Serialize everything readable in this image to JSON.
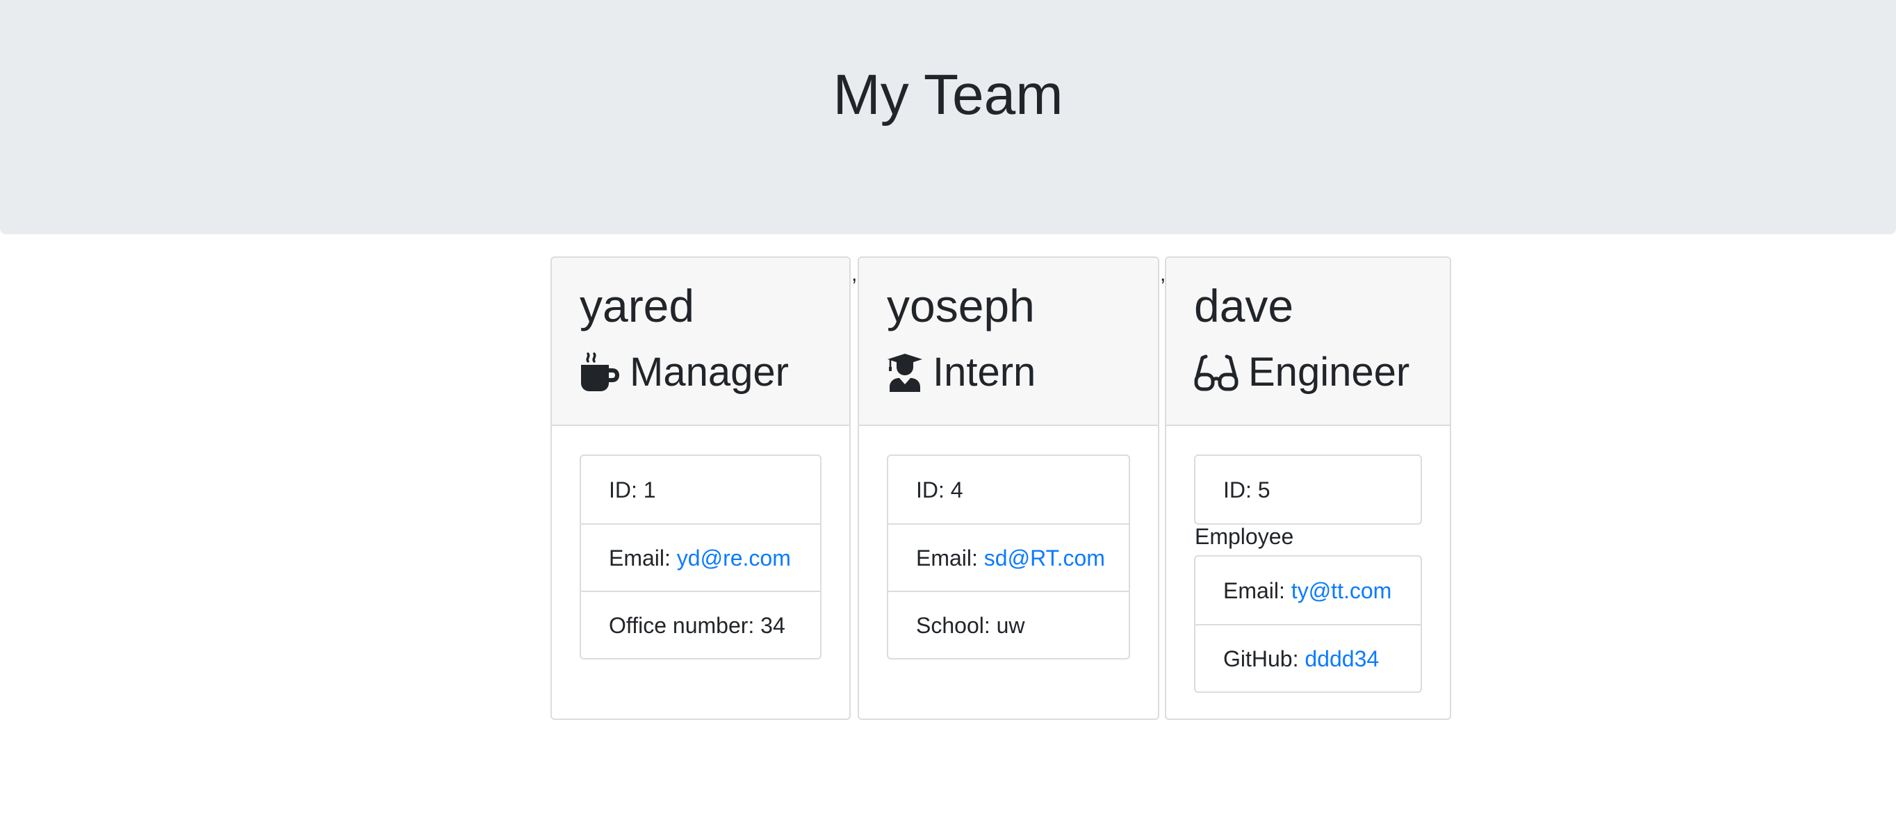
{
  "header": {
    "title": "My Team"
  },
  "separator": ",",
  "members": [
    {
      "name": "yared",
      "role": "Manager",
      "role_icon": "coffee-icon",
      "id_text": "ID: 1",
      "email_prefix": "Email: ",
      "email": "yd@re.com",
      "office_text": "Office number: 34"
    },
    {
      "name": "yoseph",
      "role": "Intern",
      "role_icon": "graduate-icon",
      "id_text": "ID: 4",
      "email_prefix": "Email: ",
      "email": "sd@RT.com",
      "school_text": "School: uw"
    },
    {
      "name": "dave",
      "role": "Engineer",
      "role_icon": "glasses-icon",
      "id_text": "ID: 5",
      "employee_label": "Employee",
      "email_prefix": "Email: ",
      "email": "ty@tt.com",
      "github_prefix": "GitHub: ",
      "github": "dddd34"
    }
  ],
  "colors": {
    "header_bg": "#e9ecef",
    "card_header_bg": "#f7f7f7",
    "link": "#0b7bff",
    "text": "#212529"
  }
}
